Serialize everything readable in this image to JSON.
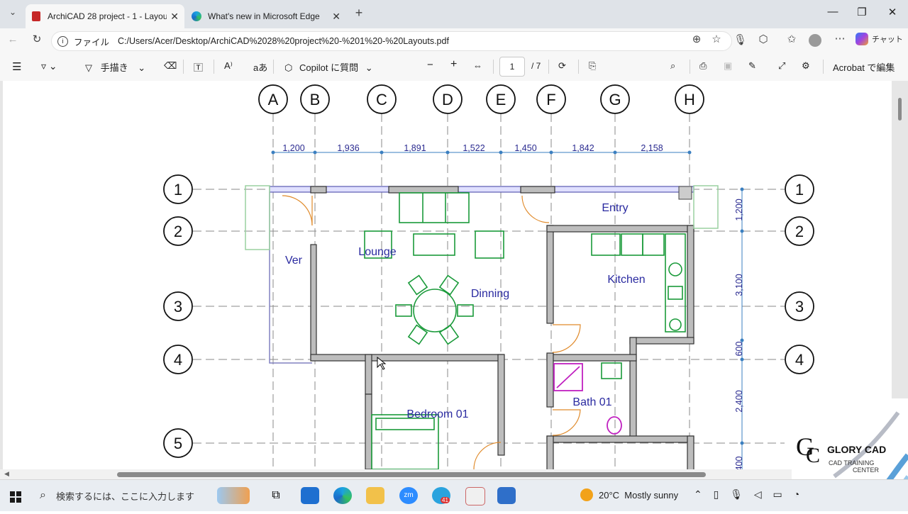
{
  "browser": {
    "tabs": [
      {
        "label": "ArchiCAD 28 project - 1 - Layouts.pdf",
        "active": true
      },
      {
        "label": "What's new in Microsoft Edge",
        "active": false
      }
    ],
    "address": {
      "scheme": "ファイル",
      "url": "C:/Users/Acer/Desktop/ArchiCAD%2028%20project%20-%201%20-%20Layouts.pdf"
    },
    "copilot_label": "チャット"
  },
  "pdf_toolbar": {
    "draw_label": "手描き",
    "copilot_label": "Copilot に質問",
    "page_current": "1",
    "page_total": "/ 7",
    "acrobat_label": "Acrobat で編集"
  },
  "plan": {
    "grid_cols": [
      "A",
      "B",
      "C",
      "D",
      "E",
      "F",
      "G",
      "H"
    ],
    "grid_rows": [
      "1",
      "2",
      "3",
      "4",
      "5"
    ],
    "dims_top": [
      "1,200",
      "1,936",
      "1,891",
      "1,522",
      "1,450",
      "1,842",
      "2,158"
    ],
    "dims_right": [
      "1,200",
      "3,100",
      "600",
      "2,400",
      "400"
    ],
    "rooms": {
      "ver": "Ver",
      "lounge": "Lounge",
      "dinning": "Dinning",
      "entry": "Entry",
      "kitchen": "Kitchen",
      "bath": "Bath 01",
      "bedroom": "Bedroom 01"
    }
  },
  "watermark": {
    "brand": "GLORY CAD",
    "sub1": "CAD TRAINING",
    "sub2": "CENTER"
  },
  "taskbar": {
    "search_placeholder": "検索するには、ここに入力します",
    "weather": "20°C  Mostly sunny",
    "telegram_badge": "41"
  },
  "colors": {
    "accent": "#1a73e8",
    "wall": "#bdbdbd",
    "furniture": "#1a9a3a",
    "label": "#2a2aa0",
    "bath_fixture": "#c020c0"
  }
}
